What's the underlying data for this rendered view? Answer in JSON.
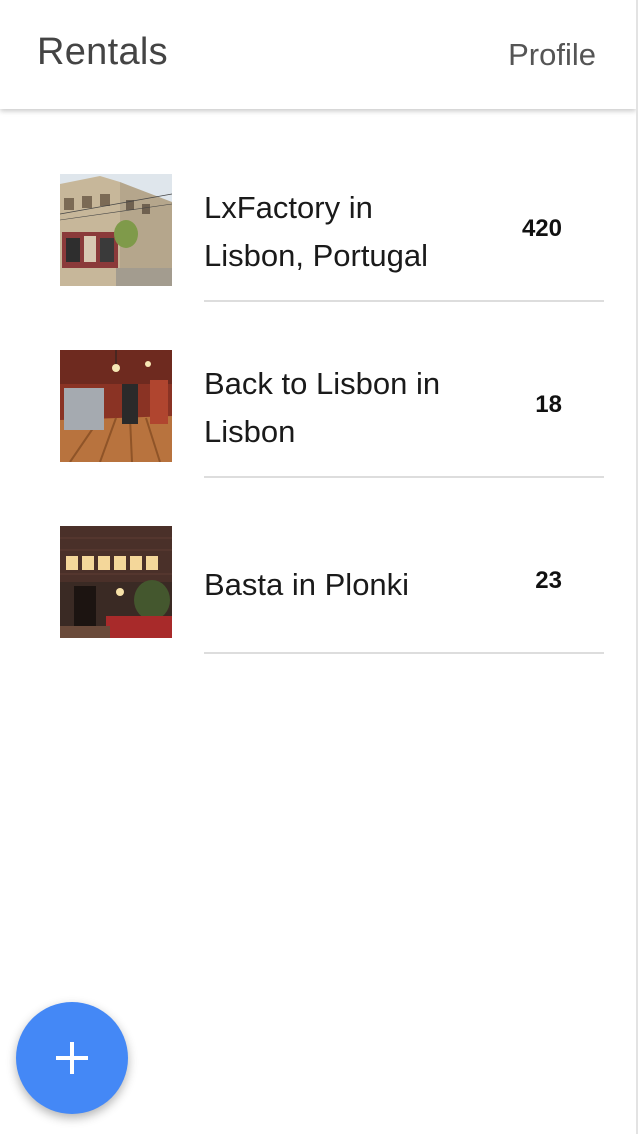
{
  "app_bar": {
    "title": "Rentals",
    "profile_label": "Profile"
  },
  "rentals": [
    {
      "title": "LxFactory in Lisbon, Portugal",
      "count": "420"
    },
    {
      "title": "Back to Lisbon in Lisbon",
      "count": "18"
    },
    {
      "title": "Basta in Plonki",
      "count": "23"
    }
  ],
  "fab": {
    "icon": "plus-icon",
    "color": "#4488f6"
  }
}
